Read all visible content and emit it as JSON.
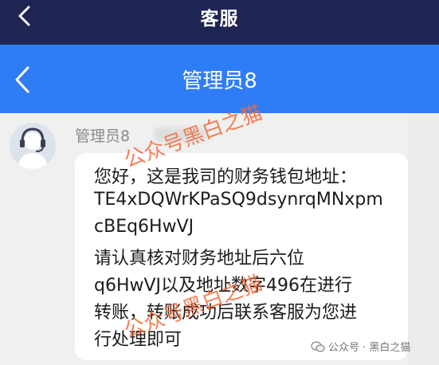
{
  "top_bar": {
    "title": "客服"
  },
  "nav_bar": {
    "title": "管理员8"
  },
  "message": {
    "sender": "管理员8",
    "lines": [
      "您好，这是我司的财务钱包地址：",
      "TE4xDQWrKPaSQ9dsynrqMNxpm",
      "cBEq6HwVJ",
      "请认真核对财务地址后六位",
      "q6HwVJ以及地址数字496在进行",
      "转账，转账成功后联系客服为您进",
      "行处理即可"
    ]
  },
  "watermarks": {
    "overlay_1": "公众号黑白之猫",
    "overlay_2": "公众号黑白之猫",
    "footer": "公众号 · 黑白之猫"
  },
  "icons": {
    "top_back": "back-chevron-icon",
    "nav_back": "back-chevron-icon",
    "avatar": "agent-headset-avatar-icon",
    "footer": "wechat-icon"
  },
  "colors": {
    "top_bar": "#1f2552",
    "nav_bar": "#2f7df6",
    "background": "#f0f0f0",
    "bubble": "#ffffff",
    "watermark": "#f26b3a"
  }
}
